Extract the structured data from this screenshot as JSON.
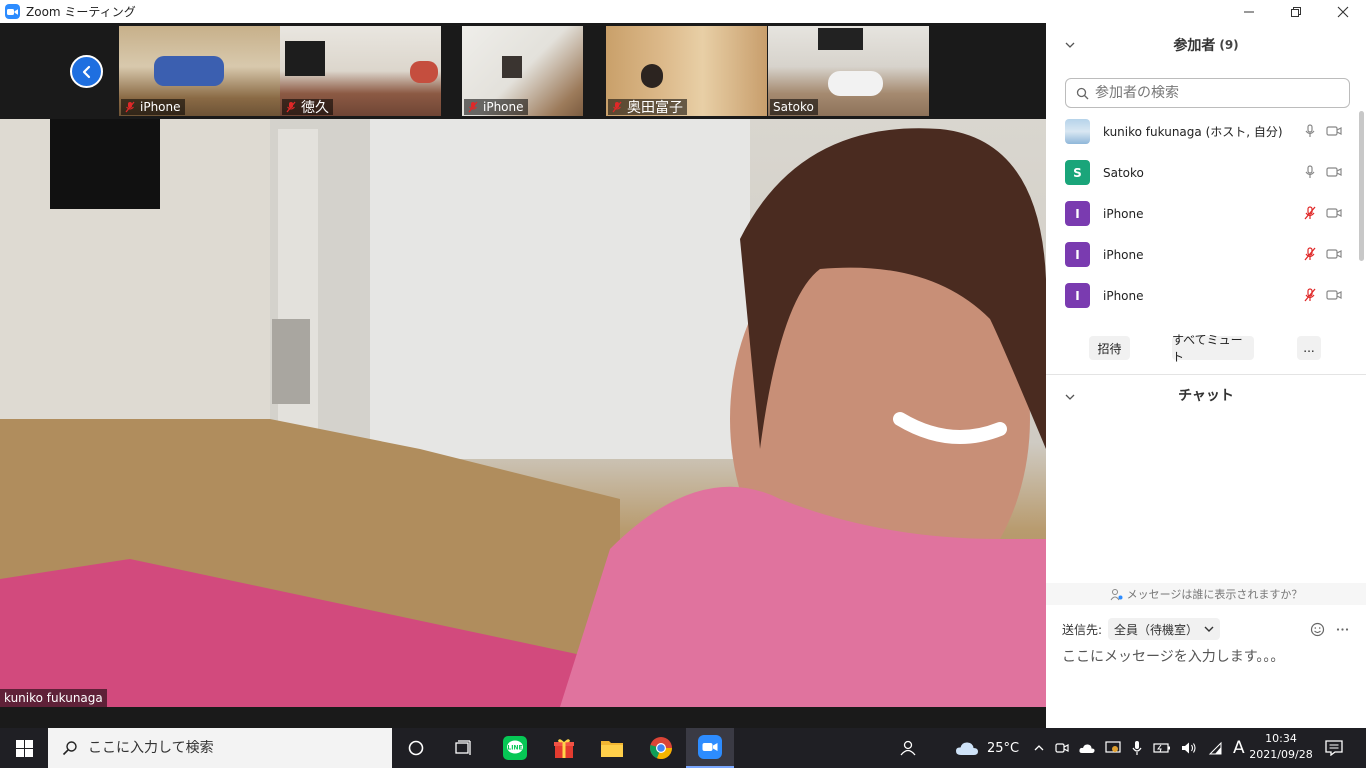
{
  "window": {
    "title": "Zoom ミーティング",
    "controls": [
      "minimize-icon",
      "restore-icon",
      "close-icon"
    ]
  },
  "filmstrip": {
    "thumbnails": [
      {
        "name": "iPhone",
        "muted": true
      },
      {
        "name": "徳久",
        "muted": true
      },
      {
        "name": "iPhone",
        "muted": true
      },
      {
        "name": "奥田富子",
        "muted": true
      },
      {
        "name": "Satoko",
        "muted": false
      }
    ]
  },
  "main_video": {
    "speaker_name": "kuniko fukunaga"
  },
  "participants_panel": {
    "title": "参加者",
    "count": "(9)",
    "search_placeholder": "参加者の検索",
    "participants": [
      {
        "name": "kuniko fukunaga (ホスト, 自分)",
        "initial": "",
        "avatar_color": "#8fb7d9",
        "mic": "on"
      },
      {
        "name": "Satoko",
        "initial": "S",
        "avatar_color": "#1aa57a",
        "mic": "on"
      },
      {
        "name": "iPhone",
        "initial": "I",
        "avatar_color": "#7a3bb0",
        "mic": "muted"
      },
      {
        "name": "iPhone",
        "initial": "I",
        "avatar_color": "#7a3bb0",
        "mic": "muted"
      },
      {
        "name": "iPhone",
        "initial": "I",
        "avatar_color": "#7a3bb0",
        "mic": "muted"
      }
    ],
    "buttons": {
      "invite": "招待",
      "mute_all": "すべてミュート",
      "more": "..."
    }
  },
  "chat_panel": {
    "title": "チャット",
    "visibility_notice": "メッセージは誰に表示されますか？",
    "send_to_label": "送信先:",
    "send_to_value": "全員（待機室）",
    "input_placeholder": "ここにメッセージを入力します。。。"
  },
  "taskbar": {
    "search_placeholder": "ここに入力して検索",
    "apps": [
      "cortana-icon",
      "task-view-icon",
      "line-icon",
      "gift-icon",
      "file-explorer-icon",
      "chrome-icon",
      "zoom-icon"
    ],
    "weather": "25°C",
    "ime_indicator": "A",
    "time": "10:34",
    "date": "2021/09/28"
  },
  "colors": {
    "zoom_blue": "#2d8cff",
    "muted_red": "#e02828",
    "taskbar_bg": "#1f1f24"
  }
}
